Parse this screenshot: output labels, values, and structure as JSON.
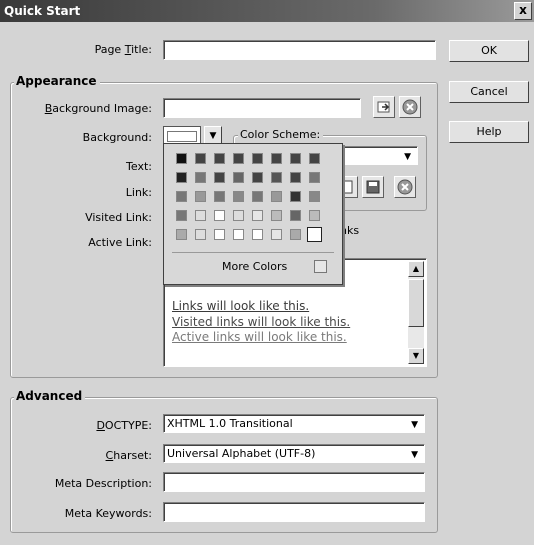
{
  "window": {
    "title": "Quick Start",
    "close": "x"
  },
  "page_title": {
    "label": "Page Title:",
    "value": ""
  },
  "buttons": {
    "ok": "OK",
    "cancel": "Cancel",
    "help": "Help"
  },
  "appearance": {
    "title": "Appearance",
    "background_image_label": "Background Image:",
    "background_image_value": "",
    "background_label": "Background:",
    "text_label": "Text:",
    "link_label": "Link:",
    "visited_link_label": "Visited Link:",
    "active_link_label": "Active Link:",
    "color_scheme_label": "Color Scheme:",
    "color_scheme_value": "",
    "links_suffix": "nks"
  },
  "palette": {
    "more_colors": "More Colors",
    "rows": [
      [
        "#111111",
        "#444444",
        "#444444",
        "#444444",
        "#444444",
        "#444444",
        "#444444",
        "#444444"
      ],
      [
        "#222222",
        "#777777",
        "#444444",
        "#666666",
        "#444444",
        "#555555",
        "#444444",
        "#777777"
      ],
      [
        "#777777",
        "#999999",
        "#777777",
        "#888888",
        "#777777",
        "#999999",
        "#333333",
        "#888888"
      ],
      [
        "#777777",
        "#dddddd",
        "#ffffff",
        "#dddddd",
        "#e6e6e6",
        "#bbbbbb",
        "#666666",
        "#bbbbbb"
      ],
      [
        "#aaaaaa",
        "#dddddd",
        "#ffffff",
        "#ffffff",
        "#ffffff",
        "#e6e6e6",
        "#aaaaaa",
        "#ffffff"
      ]
    ]
  },
  "preview": {
    "link": "Links will look like this.",
    "visited": "Visited links will look like this.",
    "active": "Active links will look like this."
  },
  "advanced": {
    "title": "Advanced",
    "doctype_label": "DOCTYPE:",
    "doctype_value": "XHTML 1.0 Transitional",
    "charset_label": "Charset:",
    "charset_value": "Universal Alphabet (UTF-8)",
    "meta_description_label": "Meta Description:",
    "meta_description_value": "",
    "meta_keywords_label": "Meta Keywords:",
    "meta_keywords_value": ""
  },
  "colors": {
    "link": "#3a3a3a",
    "visited": "#4a4a4a",
    "active": "#7a7a7a"
  }
}
